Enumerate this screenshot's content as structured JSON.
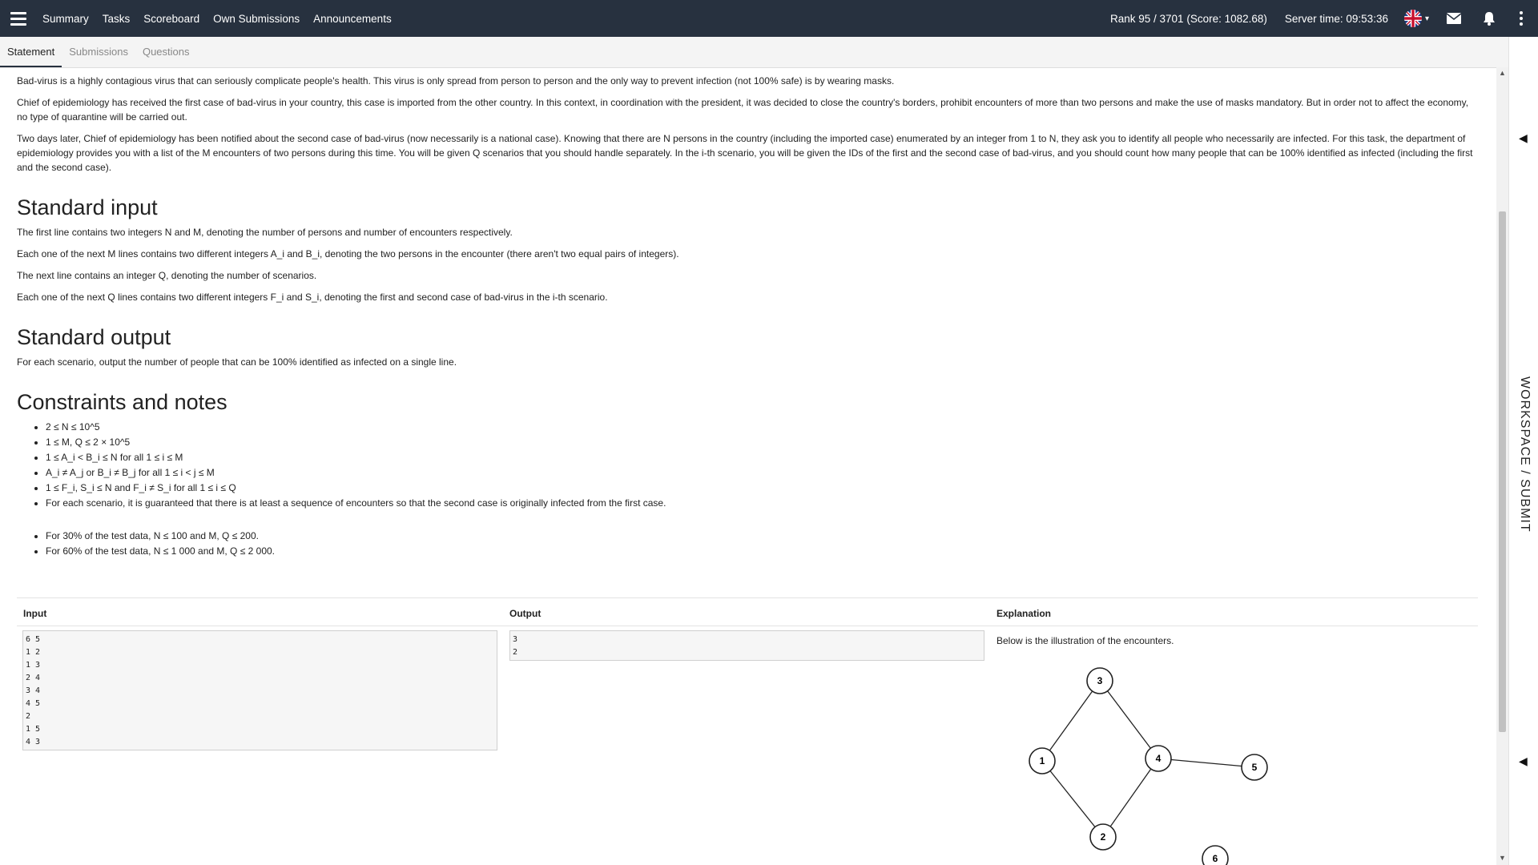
{
  "nav": {
    "items": [
      "Summary",
      "Tasks",
      "Scoreboard",
      "Own Submissions",
      "Announcements"
    ],
    "rank": "Rank 95 / 3701 (Score: 1082.68)",
    "server_time": "Server time: 09:53:36"
  },
  "tabs": [
    "Statement",
    "Submissions",
    "Questions"
  ],
  "statement": {
    "p1": "Bad-virus is a highly contagious virus that can seriously complicate people's health. This virus is only spread from person to person and the only way to prevent infection (not 100% safe) is by wearing masks.",
    "p2": "Chief of epidemiology has received the first case of bad-virus in your country, this case is imported from the other country. In this context, in coordination with the president, it was decided to close the country's borders, prohibit encounters of more than two persons and make the use of masks mandatory. But in order not to affect the economy, no type of quarantine will be carried out.",
    "p3": "Two days later, Chief of epidemiology has been notified about the second case of bad-virus (now necessarily is a national case). Knowing that there are N persons in the country (including the imported case) enumerated by an integer from 1 to N, they ask you to identify all people who necessarily are infected. For this task, the department of epidemiology provides you with a list of the M encounters of two persons during this time. You will be given Q scenarios that you should handle separately. In the i-th scenario, you will be given the IDs of the first and the second case of bad-virus, and you should count how many people that can be 100% identified as infected (including the first and the second case)."
  },
  "input_section": {
    "title": "Standard input",
    "lines": [
      "The first line contains two integers N and M, denoting the number of persons and number of encounters respectively.",
      "Each one of the next M lines contains two different integers A_i and B_i, denoting the two persons in the encounter (there aren't two equal pairs of integers).",
      "The next line contains an integer Q, denoting the number of scenarios.",
      "Each one of the next Q lines contains two different integers F_i and S_i, denoting the first and second case of bad-virus in the i-th scenario."
    ]
  },
  "output_section": {
    "title": "Standard output",
    "text": "For each scenario, output the number of people that can be 100% identified as infected on a single line."
  },
  "constraints": {
    "title": "Constraints and notes",
    "items": [
      "2 ≤ N ≤ 10^5",
      "1 ≤ M, Q ≤ 2 × 10^5",
      "1 ≤ A_i < B_i ≤ N for all 1 ≤ i ≤ M",
      "A_i ≠ A_j or B_i ≠ B_j for all 1 ≤ i < j ≤ M",
      "1 ≤ F_i, S_i ≤ N and F_i ≠ S_i for all 1 ≤ i ≤ Q",
      "For each scenario, it is guaranteed that there is at least a sequence of encounters so that the second case is originally infected from the first case."
    ],
    "subtasks": [
      "For 30% of the test data, N ≤ 100 and M, Q ≤ 200.",
      "For 60% of the test data, N ≤ 1 000 and M, Q ≤ 2 000."
    ]
  },
  "example": {
    "input_header": "Input",
    "output_header": "Output",
    "explanation_header": "Explanation",
    "input": "6 5\n1 2\n1 3\n2 4\n3 4\n4 5\n2\n1 5\n4 3",
    "output": "3\n2",
    "explanation": "Below is the illustration of the encounters.",
    "graph_nodes": [
      "1",
      "2",
      "3",
      "4",
      "5",
      "6"
    ]
  },
  "sidebar": {
    "workspace_label": "WORKSPACE / SUBMIT"
  }
}
